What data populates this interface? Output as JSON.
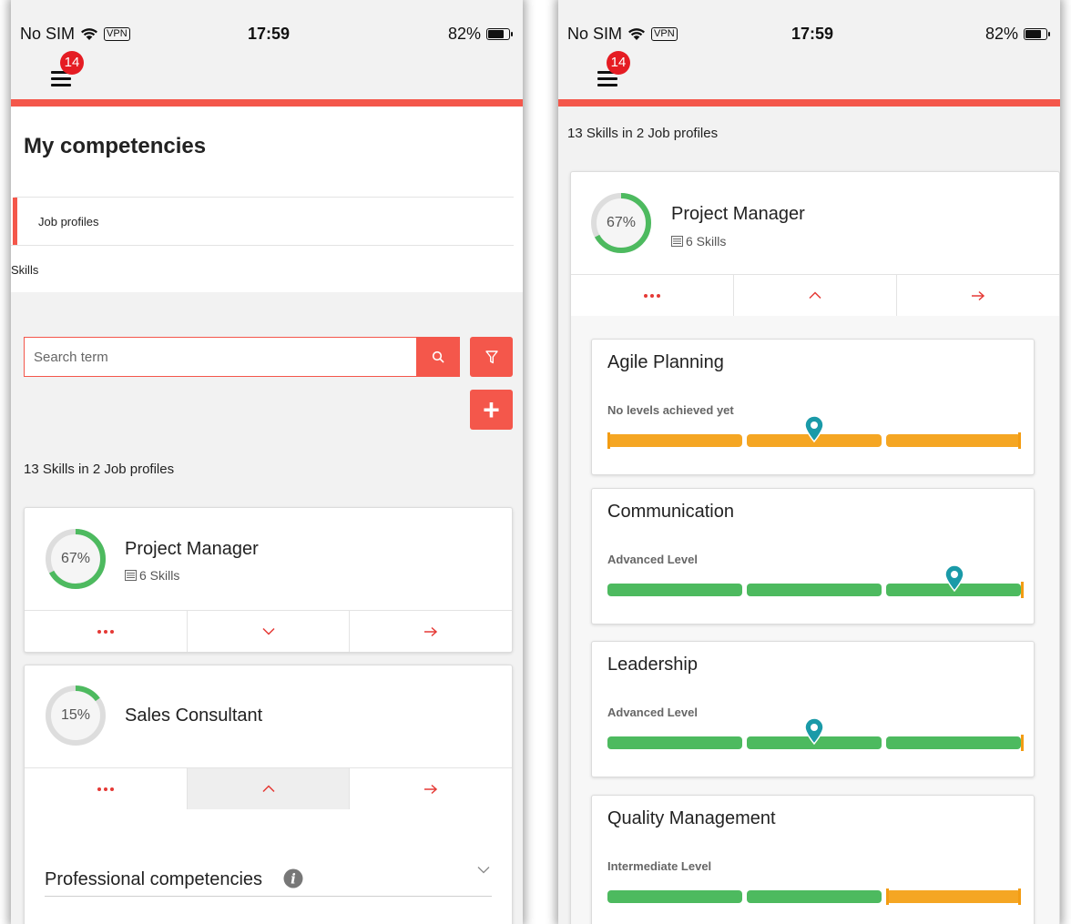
{
  "statusbar": {
    "carrier": "No SIM",
    "vpn": "VPN",
    "time": "17:59",
    "battery": "82%",
    "battery_level": 0.82
  },
  "menu": {
    "badge": "14"
  },
  "left": {
    "page_title": "My competencies",
    "tabs": [
      {
        "label": "Job profiles"
      },
      {
        "label": "Skills"
      }
    ],
    "search": {
      "placeholder": "Search term"
    },
    "summary": "13 Skills in 2 Job profiles",
    "cards": [
      {
        "percent_label": "67%",
        "percent": 67,
        "title": "Project Manager",
        "skills": "6 Skills"
      },
      {
        "percent_label": "15%",
        "percent": 15,
        "title": "Sales Consultant"
      }
    ],
    "section": {
      "title": "Professional competencies"
    }
  },
  "right": {
    "summary": "13 Skills in 2 Job profiles",
    "card": {
      "percent_label": "67%",
      "percent": 67,
      "title": "Project Manager",
      "skills": "6 Skills"
    },
    "skills": [
      {
        "name": "Agile Planning",
        "level": "No levels achieved yet",
        "segments": [
          "orange",
          "orange",
          "orange"
        ],
        "marker_position": 0.5,
        "brackets": "full"
      },
      {
        "name": "Communication",
        "level": "Advanced Level",
        "segments": [
          "green",
          "green",
          "green"
        ],
        "marker_position": 0.84,
        "brackets": "end"
      },
      {
        "name": "Leadership",
        "level": "Advanced Level",
        "segments": [
          "green",
          "green",
          "green"
        ],
        "marker_position": 0.5,
        "brackets": "end"
      },
      {
        "name": "Quality Management",
        "level": "Intermediate Level",
        "segments": [
          "green",
          "green",
          "orange"
        ],
        "marker_position": null,
        "brackets": "third"
      }
    ]
  },
  "colors": {
    "accent": "#f4574b",
    "progress_green": "#4dba5f",
    "progress_track": "#dddddd",
    "orange": "#f5a623",
    "green": "#4dba5f",
    "marker": "#1a9aa8",
    "action_red": "#e53935"
  },
  "icons": {
    "menu": "hamburger-icon",
    "search": "search-icon",
    "filter": "filter-icon",
    "add": "plus-icon",
    "more": "more-dots-icon",
    "expand": "chevron-down-icon",
    "collapse": "chevron-up-icon",
    "open": "arrow-right-icon",
    "info": "info-icon",
    "skills": "list-icon",
    "marker": "map-pin-icon"
  }
}
